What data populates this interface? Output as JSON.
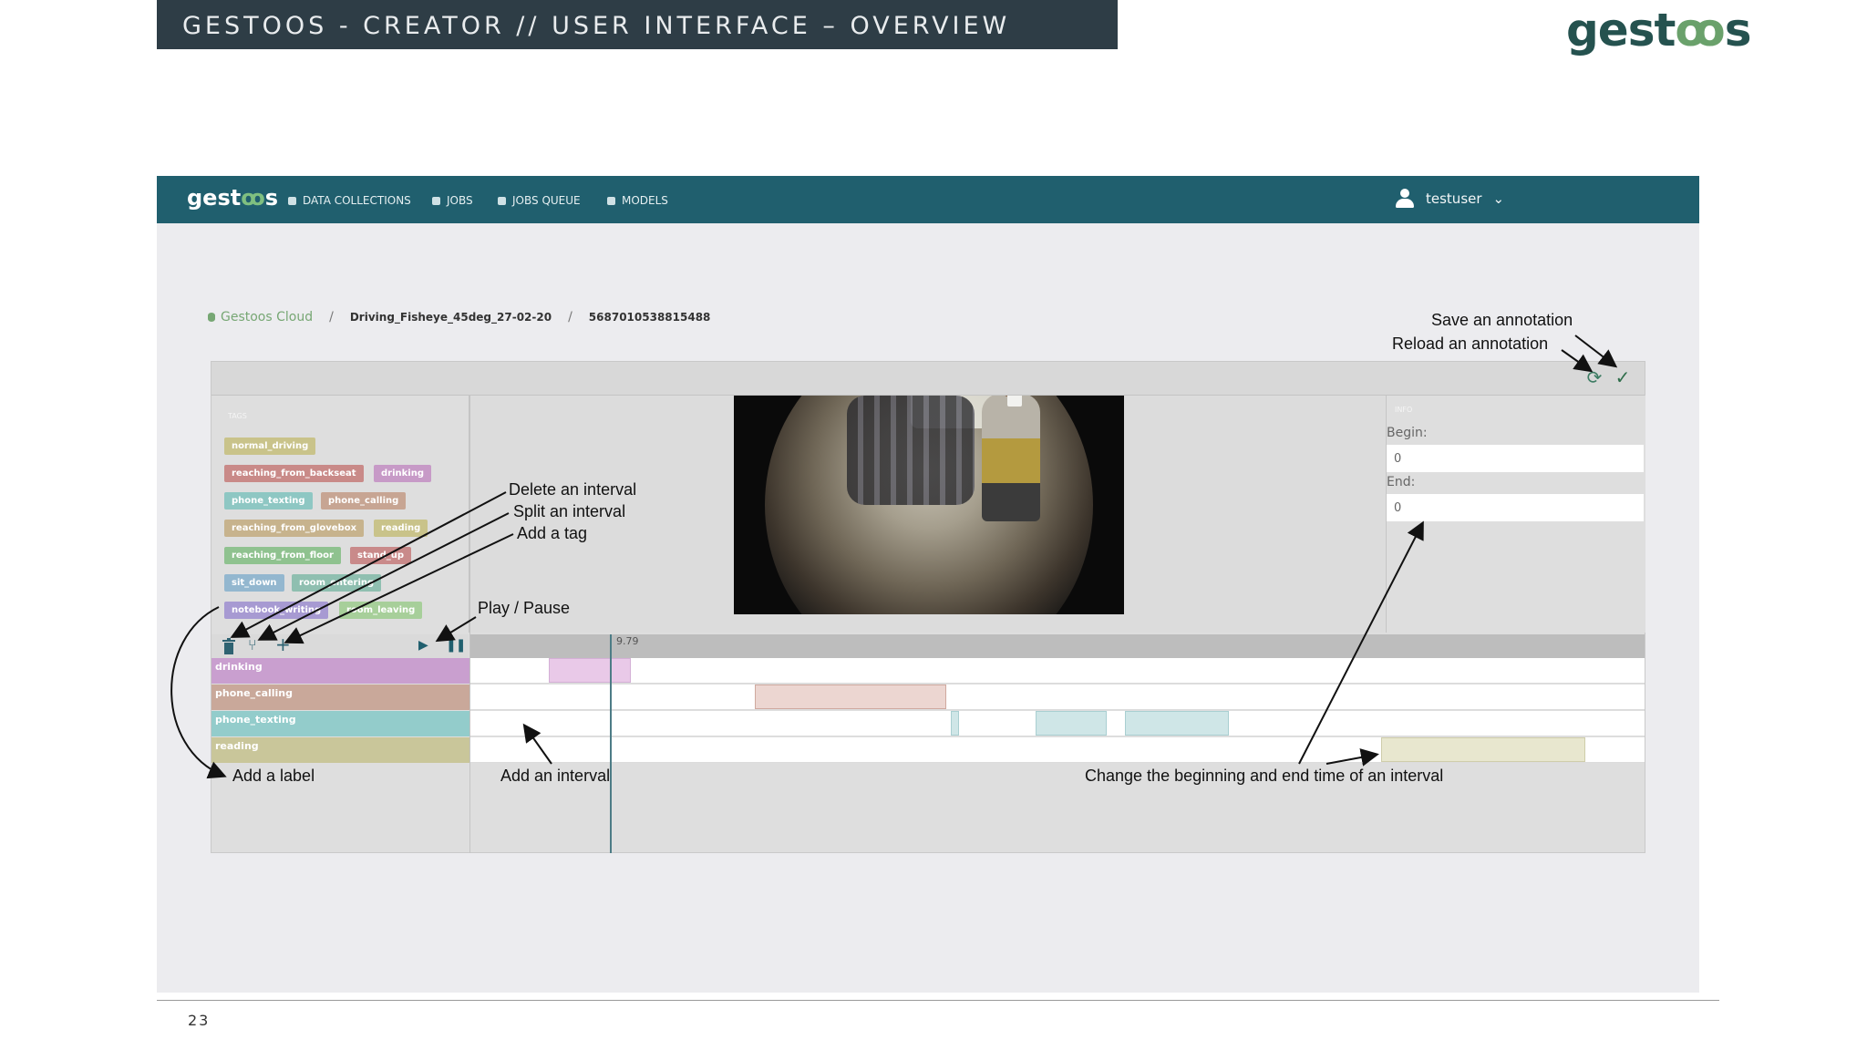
{
  "slide": {
    "title": "GESTOOS - CREATOR // USER INTERFACE – OVERVIEW",
    "logo_prefix": "gest",
    "logo_suffix": "s",
    "page_number": "23"
  },
  "navbar": {
    "logo_prefix": "gest",
    "logo_suffix": "s",
    "items": [
      {
        "label": "DATA COLLECTIONS",
        "icon": "database-icon"
      },
      {
        "label": "JOBS",
        "icon": "person-icon"
      },
      {
        "label": "JOBS QUEUE",
        "icon": "queue-icon"
      },
      {
        "label": "MODELS",
        "icon": "models-icon"
      }
    ],
    "user": "testuser"
  },
  "breadcrumb": {
    "home": "Gestoos Cloud",
    "collection": "Driving_Fisheye_45deg_27-02-20",
    "item": "5687010538815488"
  },
  "tags": {
    "heading": "TAGS",
    "items": [
      {
        "label": "normal_driving",
        "color": "#c9c38a"
      },
      {
        "label": "reaching_from_backseat",
        "color": "#c98a88"
      },
      {
        "label": "drinking",
        "color": "#c79ac7"
      },
      {
        "label": "phone_texting",
        "color": "#8ec7c3"
      },
      {
        "label": "phone_calling",
        "color": "#c7a593"
      },
      {
        "label": "reaching_from_glovebox",
        "color": "#c7b38d"
      },
      {
        "label": "reading",
        "color": "#c9c38a"
      },
      {
        "label": "reaching_from_floor",
        "color": "#8fc28f"
      },
      {
        "label": "stand_up",
        "color": "#c98a8a"
      },
      {
        "label": "sit_down",
        "color": "#93b7cf"
      },
      {
        "label": "room_entering",
        "color": "#8fbfb0"
      },
      {
        "label": "notebook_writing",
        "color": "#a79ad2"
      },
      {
        "label": "room_leaving",
        "color": "#a7cf9a"
      }
    ]
  },
  "info": {
    "heading": "INFO",
    "begin_label": "Begin:",
    "begin_value": "0",
    "end_label": "End:",
    "end_value": "0"
  },
  "timeline": {
    "current_time": "9.79",
    "tracks": [
      {
        "label": "drinking",
        "color": "#c99fcf",
        "interval_color": "#e9c9e8"
      },
      {
        "label": "phone_calling",
        "color": "#c9a89a",
        "interval_color": "#ecd6d1"
      },
      {
        "label": "phone_texting",
        "color": "#93cccb",
        "interval_color": "#cfe6e7"
      },
      {
        "label": "reading",
        "color": "#c9c69a",
        "interval_color": "#e8e7cf"
      }
    ]
  },
  "annotations": {
    "save": "Save an annotation",
    "reload": "Reload an annotation",
    "delete_interval": "Delete an interval",
    "split_interval": "Split an interval",
    "add_tag": "Add a tag",
    "play_pause": "Play / Pause",
    "add_label": "Add a label",
    "add_interval": "Add an interval",
    "change_time": "Change the beginning and end time of an interval"
  },
  "colors": {
    "navbar": "#205f6e",
    "slide_header": "#2e3d46",
    "brand": "#25524f",
    "brand_accent": "#6aa16b"
  }
}
